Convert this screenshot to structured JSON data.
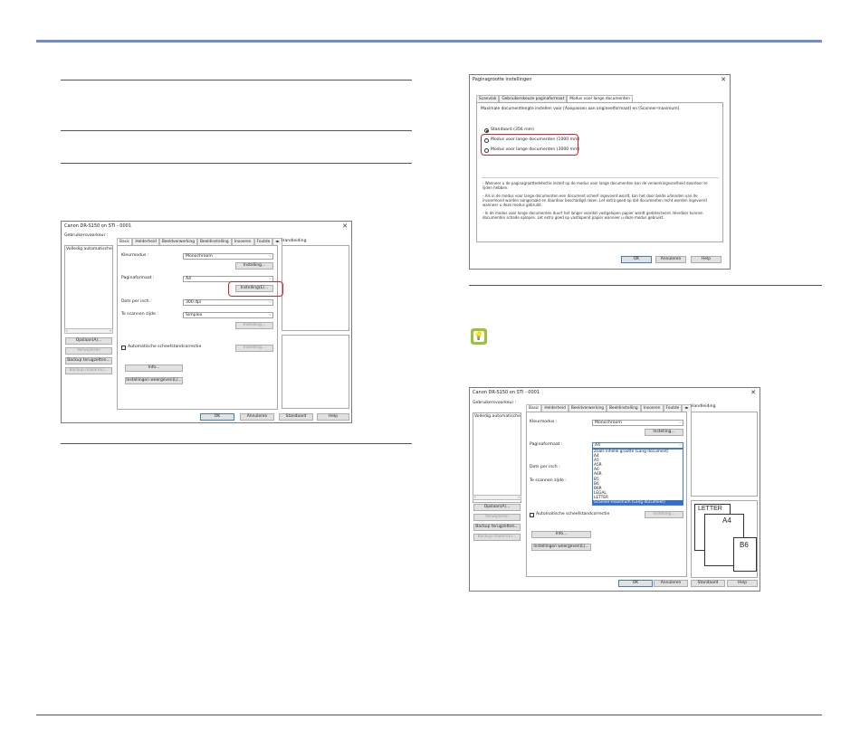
{
  "dialog1": {
    "title": "Canon DR-S150 on STI - 0001",
    "user_pref_label": "Gebruikersvoorkeur :",
    "user_pref_item": "Volledig automatische",
    "tabs": [
      "Basic",
      "Helderheid",
      "Beeldverwerking",
      "Beeldinstelling",
      "Invoeren",
      "Foutde"
    ],
    "manual_label": "Handleiding",
    "color_mode_label": "Kleurmodus :",
    "color_mode_value": "Monochroom",
    "setting_button": "Instelling...",
    "page_size_label": "Paginaformaat :",
    "page_size_value": "A4",
    "setting_e_button": "Instelling(E)...",
    "dpi_label": "Dots per inch :",
    "dpi_value": "300 dpi",
    "side_label": "Te scannen zijde :",
    "side_value": "Simplex",
    "setting_disabled": "Instelling...",
    "auto_skew_label": "Automatische scheefstandcorrectie",
    "info_button": "Info...",
    "show_settings_button": "Instellingen weergeven(L)...",
    "save_button": "Opslaan(A)...",
    "delete_button": "Verwijderen",
    "backup_button": "Backup terugzetten...",
    "backup_make_button": "Backup maken(E)...",
    "ok": "OK",
    "cancel": "Annuleren",
    "default": "Standaard",
    "help": "Help"
  },
  "dialog2": {
    "title": "Paginagrootte instellingen",
    "tabs": [
      "Scanvlak",
      "Gebruikerskeuze paginaformaat",
      "Modus voor lange documenten"
    ],
    "description": "Maximale documentlengte instellen voor [Aanpassen aan origineelformaat] en [Scanner-maximum].",
    "radio_standard": "Standaard (356 mm)",
    "radio_long1": "Modus voor lange documenten (1000 mm)",
    "radio_long3": "Modus voor lange documenten (3000 mm)",
    "note1": "- Wanneer u de paginagroottedetectie instelt op de modus voor lange documenten kan de verwerkingssnelheid daardoor te lijden hebben.",
    "note2": "- Als in de modus voor lange documenten een document scheef ingevoerd wordt, kan het door beide uiteinden van de invoermond worden aangeraakt en daardoor beschadigd raken. Let extra goed op dat documenten recht worden ingevoerd wanneer u deze modus gebruikt.",
    "note3": "- In de modus voor lange documenten duurt het langer voordat vastgelopen papier wordt gedetecteerd. Hierdoor kunnen documenten schade oplopen. Let extra goed op vastlopend papier wanneer u deze modus gebruikt.",
    "ok": "OK",
    "cancel": "Annuleren",
    "help": "Help"
  },
  "dialog3": {
    "title": "Canon DR-S150 on STI - 0001",
    "user_pref_label": "Gebruikersvoorkeur :",
    "user_pref_item": "Volledig automatische",
    "tabs": [
      "Basic",
      "Helderheid",
      "Beeldverwerking",
      "Beeldinstelling",
      "Invoeren",
      "Foutde"
    ],
    "manual_label": "Handleiding",
    "color_mode_label": "Kleurmodus :",
    "color_mode_value": "Monochroom",
    "setting_button": "Instelling...",
    "page_size_label": "Paginaformaat :",
    "page_size_value": "A4",
    "page_size_options": [
      "Zoals inhelle grootte (Lang document)",
      "A4",
      "A5",
      "A5R",
      "A6",
      "A6R",
      "B5",
      "B6",
      "B6R",
      "LEGAL",
      "LETTER",
      "Scanner-maximum (Lang document)"
    ],
    "dpi_label": "Dots per inch :",
    "side_label": "Te scannen zijde :",
    "auto_skew_label": "Automatische scheefstandcorrectie",
    "setting_disabled": "Instelling...",
    "info_button": "Info...",
    "show_settings_button": "Instellingen weergeven(L)...",
    "save_button": "Opslaan(A)...",
    "delete_button": "Verwijderen",
    "backup_button": "Backup terugzetten...",
    "backup_make_button": "Backup maken(E)...",
    "preview_letter": "LETTER",
    "preview_a4": "A4",
    "preview_b6": "B6",
    "ok": "OK",
    "cancel": "Annuleren",
    "default": "Standaard",
    "help": "Help"
  },
  "tip_icon": "lightbulb-icon",
  "colors": {
    "accent_bar": "#6f8fc7",
    "highlight": "#e0202a",
    "tip": "#9bc33a",
    "selection": "#2f6fd6"
  }
}
